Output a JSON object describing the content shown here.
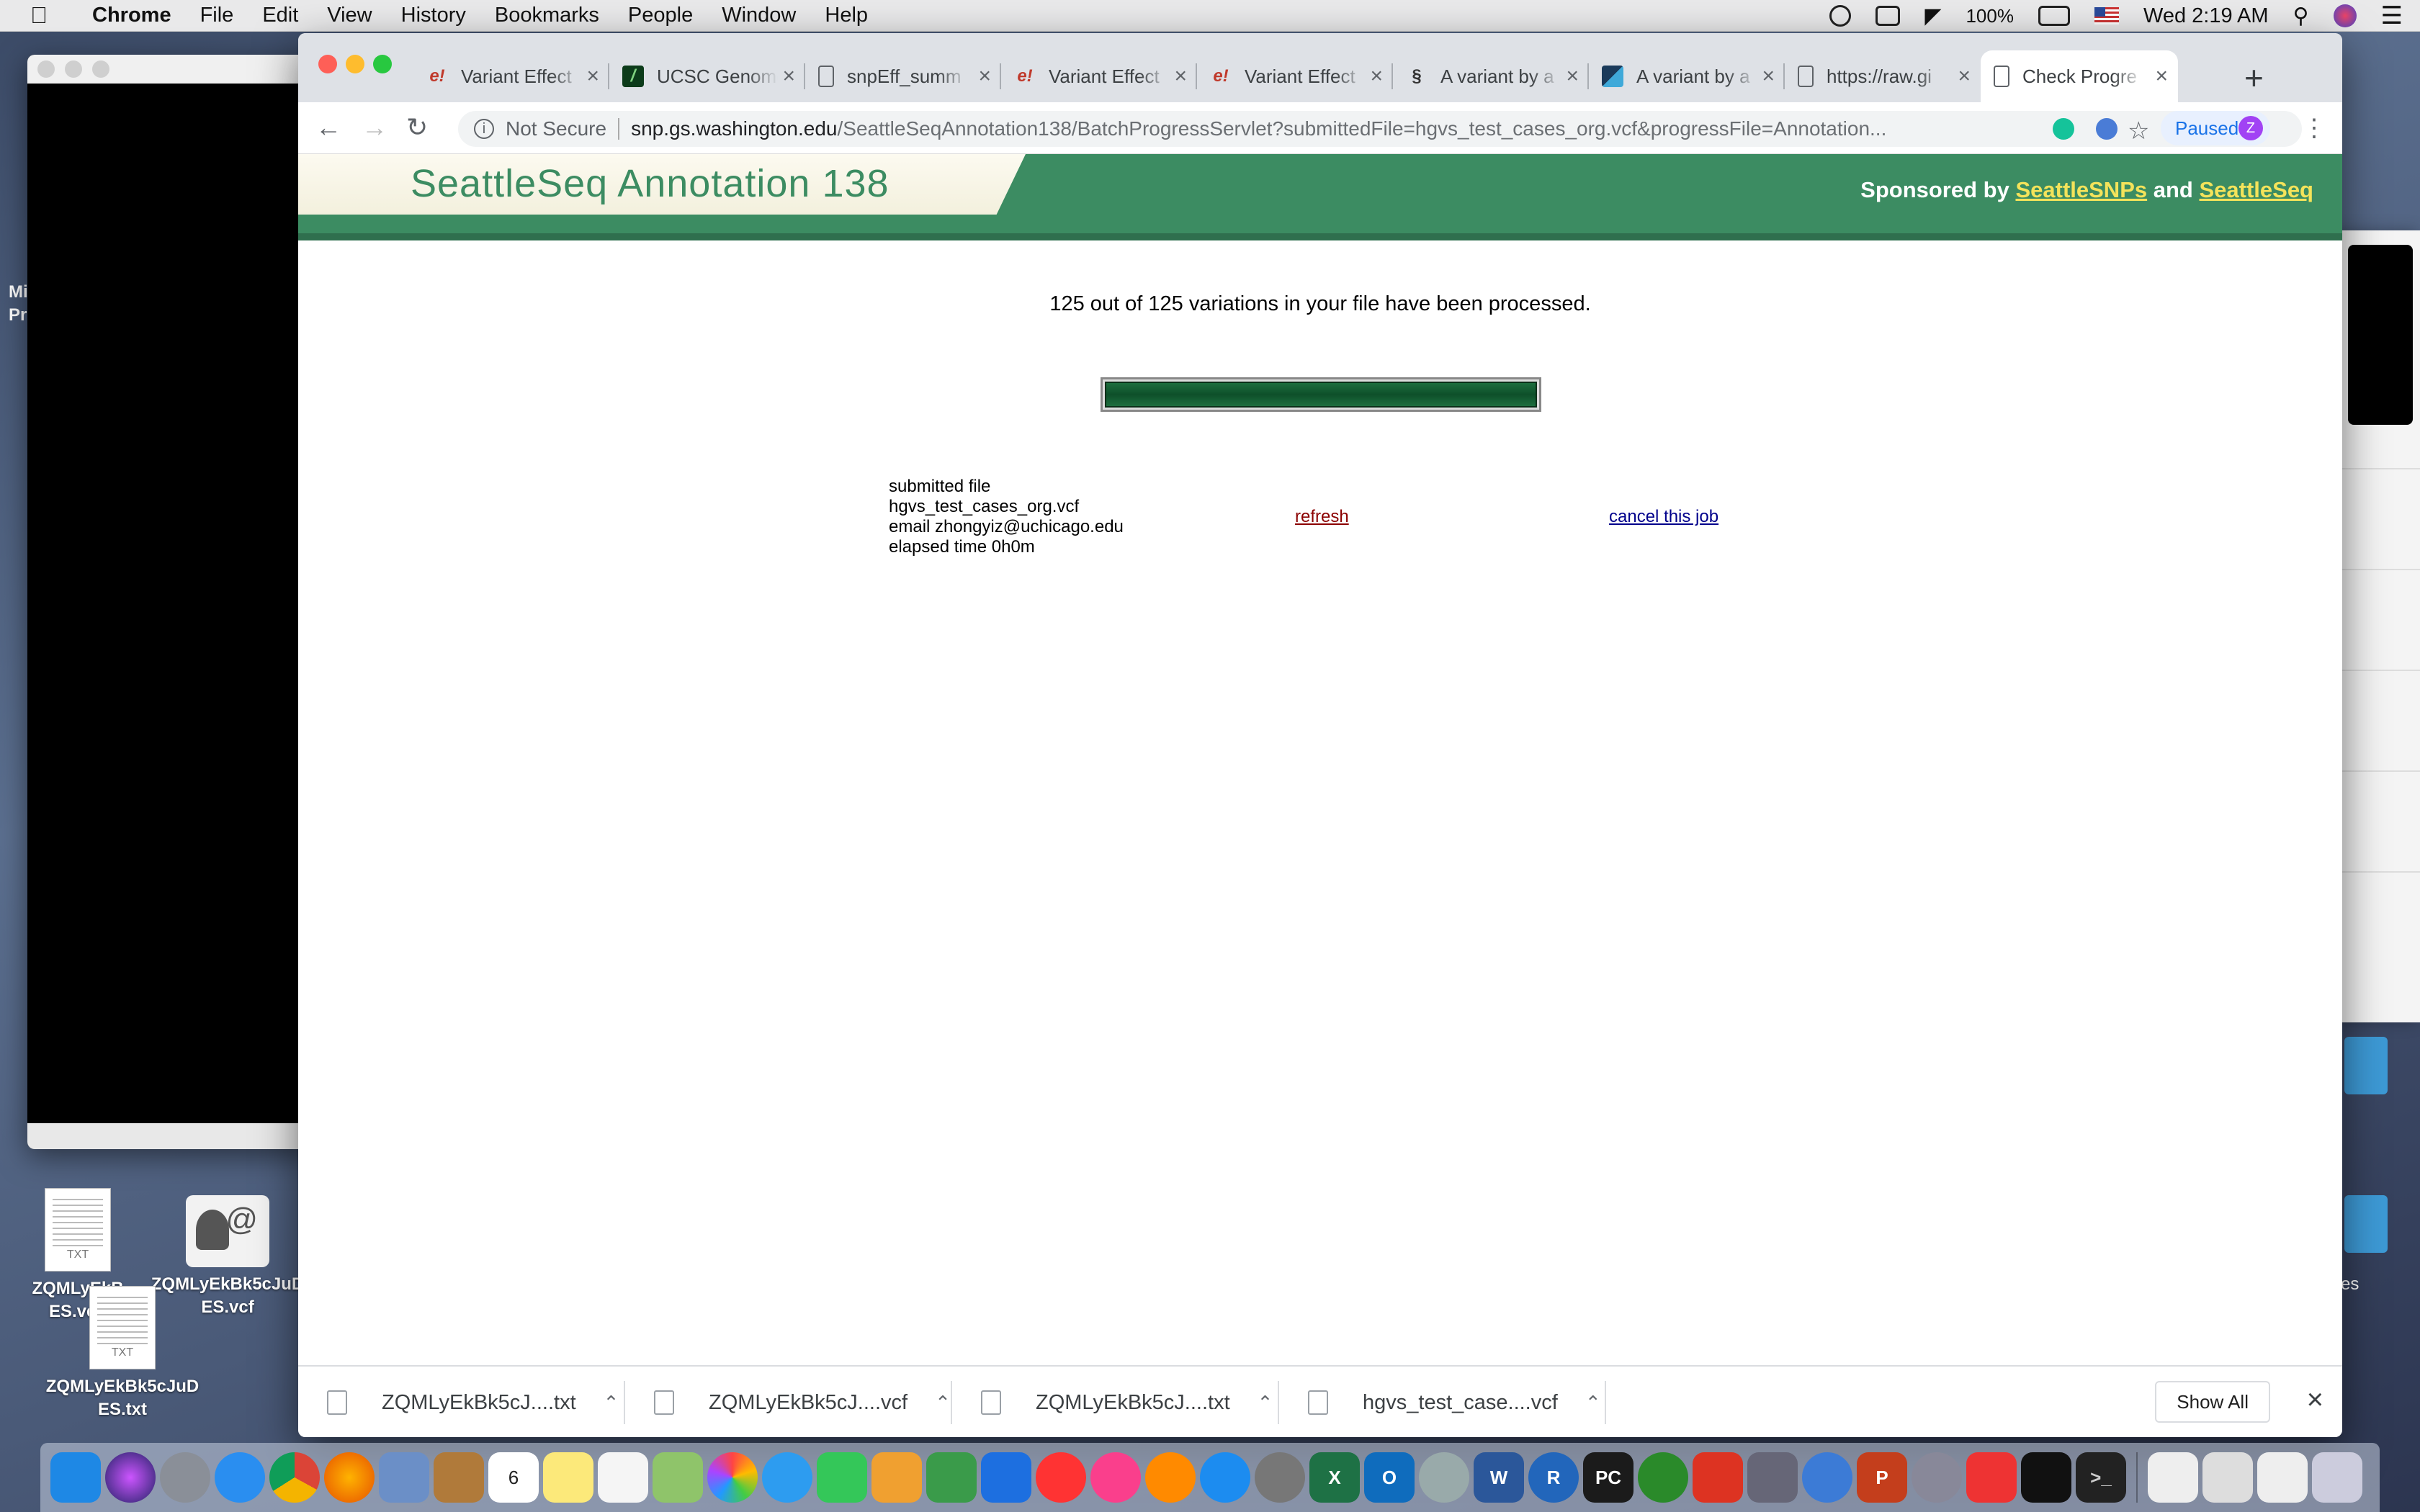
{
  "menubar": {
    "app": "Chrome",
    "items": [
      "File",
      "Edit",
      "View",
      "History",
      "Bookmarks",
      "People",
      "Window",
      "Help"
    ],
    "battery": "100%",
    "clock": "Wed 2:19 AM"
  },
  "desktop": {
    "left_peek_text": [
      "Mi",
      "Pr"
    ],
    "right_peek_text": "es",
    "icons": [
      {
        "label_line1": "ZQMLyEkB",
        "label_line2": "ES.vep",
        "kind": "txt"
      },
      {
        "label_line1": "ZQMLyEkBk5cJuD",
        "label_line2": "ES.vcf",
        "kind": "contact"
      },
      {
        "label_line1": "ZQMLyEkBk5cJuD",
        "label_line2": "ES.txt",
        "kind": "txt"
      }
    ]
  },
  "tabs": [
    {
      "title": "Variant Effect",
      "icon": "ensembl-icon",
      "active": false
    },
    {
      "title": "UCSC Genome",
      "icon": "ucsc-icon",
      "active": false
    },
    {
      "title": "snpEff_summ",
      "icon": "document-icon",
      "active": false
    },
    {
      "title": "Variant Effect",
      "icon": "ensembl-icon",
      "active": false
    },
    {
      "title": "Variant Effect",
      "icon": "ensembl-icon",
      "active": false
    },
    {
      "title": "A variant by a",
      "icon": "mutalyzer-icon",
      "active": false
    },
    {
      "title": "A variant by a",
      "icon": "bookmark-icon",
      "active": false
    },
    {
      "title": "https://raw.gi",
      "icon": "document-icon",
      "active": false
    },
    {
      "title": "Check Progre",
      "icon": "document-icon",
      "active": true
    }
  ],
  "toolbar": {
    "security_label": "Not Secure",
    "url_host": "snp.gs.washington.edu",
    "url_path": "/SeattleSeqAnnotation138/BatchProgressServlet?submittedFile=hgvs_test_cases_org.vcf&progressFile=Annotation...",
    "profile_label": "Paused",
    "profile_initial": "Z"
  },
  "page": {
    "site_title": "SeattleSeq Annotation 138",
    "sponsor_prefix": "Sponsored by",
    "sponsor_link1": "SeattleSNPs",
    "sponsor_and": "and",
    "sponsor_link2": "SeattleSeq",
    "status_message": "125 out of 125 variations in your file have been processed.",
    "progress_fraction": 1.0,
    "submitted_file_label": "submitted file",
    "submitted_file": "hgvs_test_cases_org.vcf",
    "email": "email zhongyiz@uchicago.edu",
    "elapsed": "elapsed time 0h0m",
    "refresh_label": "refresh",
    "cancel_label": "cancel this job",
    "colors": {
      "banner_green": "#3c8c62",
      "sponsor_link": "#f4e35a",
      "refresh": "#8b0000",
      "cancel": "#00008b"
    }
  },
  "downloads": {
    "items": [
      {
        "name": "ZQMLyEkBk5cJ....txt"
      },
      {
        "name": "ZQMLyEkBk5cJ....vcf"
      },
      {
        "name": "ZQMLyEkBk5cJ....txt"
      },
      {
        "name": "hgvs_test_case....vcf"
      }
    ],
    "show_all": "Show All"
  },
  "dock": {
    "calendar_day": "6"
  }
}
